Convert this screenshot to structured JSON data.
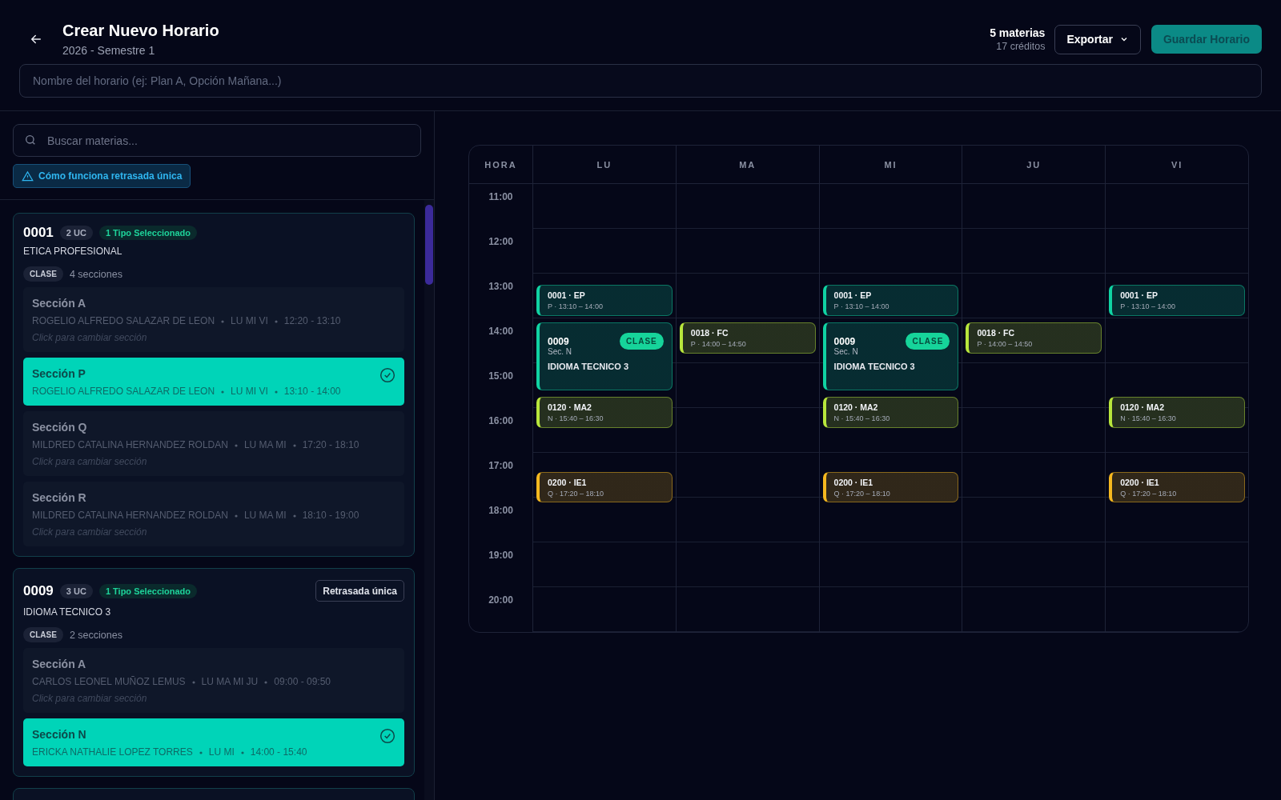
{
  "header": {
    "title": "Crear Nuevo Horario",
    "subtitle": "2026 - Semestre 1",
    "summary": {
      "subjects": "5 materias",
      "credits": "17 créditos"
    },
    "export_button": "Exportar",
    "save_button": "Guardar Horario"
  },
  "name_field": {
    "placeholder": "Nombre del horario (ej: Plan A, Opción Mañana...)"
  },
  "search": {
    "placeholder": "Buscar materias..."
  },
  "info_badge": "Cómo funciona retrasada única",
  "courses": [
    {
      "code": "0001",
      "credits": "2 UC",
      "status": "1 Tipo Seleccionado",
      "name": "ETICA PROFESIONAL",
      "groups": [
        {
          "type": "CLASE",
          "count": "4 secciones",
          "sections": [
            {
              "title": "Sección A",
              "teacher": "ROGELIO ALFREDO SALAZAR DE LEON",
              "days": "LU MI VI",
              "time": "12:20 - 13:10",
              "hint": "Click para cambiar sección",
              "selected": false
            },
            {
              "title": "Sección P",
              "teacher": "ROGELIO ALFREDO SALAZAR DE LEON",
              "days": "LU MI VI",
              "time": "13:10 - 14:00",
              "selected": true
            },
            {
              "title": "Sección Q",
              "teacher": "MILDRED CATALINA HERNANDEZ ROLDAN",
              "days": "LU MA MI",
              "time": "17:20 - 18:10",
              "hint": "Click para cambiar sección",
              "selected": false
            },
            {
              "title": "Sección R",
              "teacher": "MILDRED CATALINA HERNANDEZ ROLDAN",
              "days": "LU MA MI",
              "time": "18:10 - 19:00",
              "hint": "Click para cambiar sección",
              "selected": false
            }
          ]
        }
      ]
    },
    {
      "code": "0009",
      "credits": "3 UC",
      "status": "1 Tipo Seleccionado",
      "name": "IDIOMA TECNICO 3",
      "late_button": "Retrasada única",
      "groups": [
        {
          "type": "CLASE",
          "count": "2 secciones",
          "sections": [
            {
              "title": "Sección A",
              "teacher": "CARLOS LEONEL MUÑOZ LEMUS",
              "days": "LU MA MI JU",
              "time": "09:00 - 09:50",
              "hint": "Click para cambiar sección",
              "selected": false
            },
            {
              "title": "Sección N",
              "teacher": "ERICKA NATHALIE LOPEZ TORRES",
              "days": "LU MI",
              "time": "14:00 - 15:40",
              "selected": true
            }
          ]
        }
      ]
    }
  ],
  "calendar": {
    "time_header": "HORA",
    "hours": [
      "11:00",
      "12:00",
      "13:00",
      "14:00",
      "15:00",
      "16:00",
      "17:00",
      "18:00",
      "19:00",
      "20:00"
    ],
    "days": [
      {
        "label": "LU",
        "events": [
          {
            "kind": "compact",
            "title": "0001 · EP",
            "detail": "P · 13:10 – 14:00",
            "color": "#10d3a3"
          },
          {
            "kind": "block",
            "code": "0009",
            "section": "Sec. N",
            "name": "IDIOMA TECNICO 3",
            "tag": "CLASE",
            "color": "#10d3a3"
          },
          {
            "kind": "compact",
            "title": "0120 · MA2",
            "detail": "N · 15:40 – 16:30",
            "color": "#b8e63c"
          },
          {
            "kind": "compact",
            "title": "0200 · IE1",
            "detail": "Q · 17:20 – 18:10",
            "color": "#f5b81f"
          }
        ]
      },
      {
        "label": "MA",
        "events": [
          {
            "kind": "compact",
            "title": "0018 · FC",
            "detail": "P · 14:00 – 14:50",
            "color": "#b8e63c"
          }
        ]
      },
      {
        "label": "MI",
        "events": [
          {
            "kind": "compact",
            "title": "0001 · EP",
            "detail": "P · 13:10 – 14:00",
            "color": "#10d3a3"
          },
          {
            "kind": "block",
            "code": "0009",
            "section": "Sec. N",
            "name": "IDIOMA TECNICO 3",
            "tag": "CLASE",
            "color": "#10d3a3"
          },
          {
            "kind": "compact",
            "title": "0120 · MA2",
            "detail": "N · 15:40 – 16:30",
            "color": "#b8e63c"
          },
          {
            "kind": "compact",
            "title": "0200 · IE1",
            "detail": "Q · 17:20 – 18:10",
            "color": "#f5b81f"
          }
        ]
      },
      {
        "label": "JU",
        "events": [
          {
            "kind": "compact",
            "title": "0018 · FC",
            "detail": "P · 14:00 – 14:50",
            "color": "#b8e63c"
          }
        ]
      },
      {
        "label": "VI",
        "events": [
          {
            "kind": "compact",
            "title": "0001 · EP",
            "detail": "P · 13:10 – 14:00",
            "color": "#10d3a3"
          },
          {
            "kind": "compact",
            "title": "0120 · MA2",
            "detail": "N · 15:40 – 16:30",
            "color": "#b8e63c"
          },
          {
            "kind": "compact",
            "title": "0200 · IE1",
            "detail": "Q · 17:20 – 18:10",
            "color": "#f5b81f"
          }
        ]
      }
    ]
  }
}
